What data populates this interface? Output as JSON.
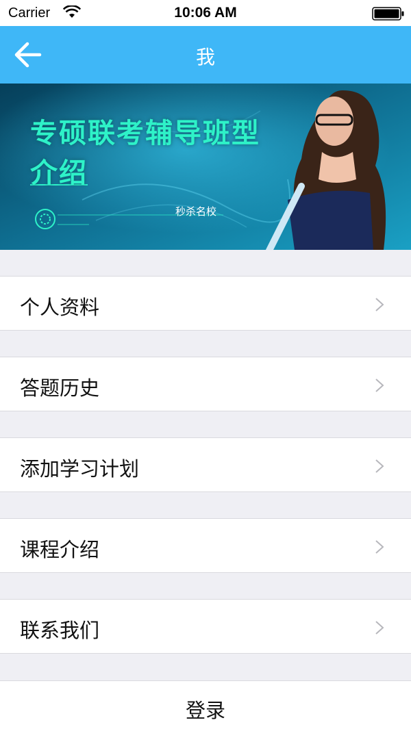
{
  "status": {
    "carrier": "Carrier",
    "time": "10:06 AM"
  },
  "nav": {
    "title": "我",
    "back_icon": "arrow-left-icon"
  },
  "banner": {
    "title_line1": "专硕联考辅导班型",
    "title_line2": "介绍",
    "subtitle": "秒杀名校"
  },
  "menu": {
    "items": [
      {
        "label": "个人资料",
        "icon": "chevron-right-icon"
      },
      {
        "label": "答题历史",
        "icon": "chevron-right-icon"
      },
      {
        "label": "添加学习计划",
        "icon": "chevron-right-icon"
      },
      {
        "label": "课程介绍",
        "icon": "chevron-right-icon"
      },
      {
        "label": "联系我们",
        "icon": "chevron-right-icon"
      }
    ]
  },
  "login": {
    "label": "登录"
  },
  "colors": {
    "nav_background": "#3fb7f7",
    "page_background": "#efeff4",
    "banner_text": "#2ef2c8"
  }
}
